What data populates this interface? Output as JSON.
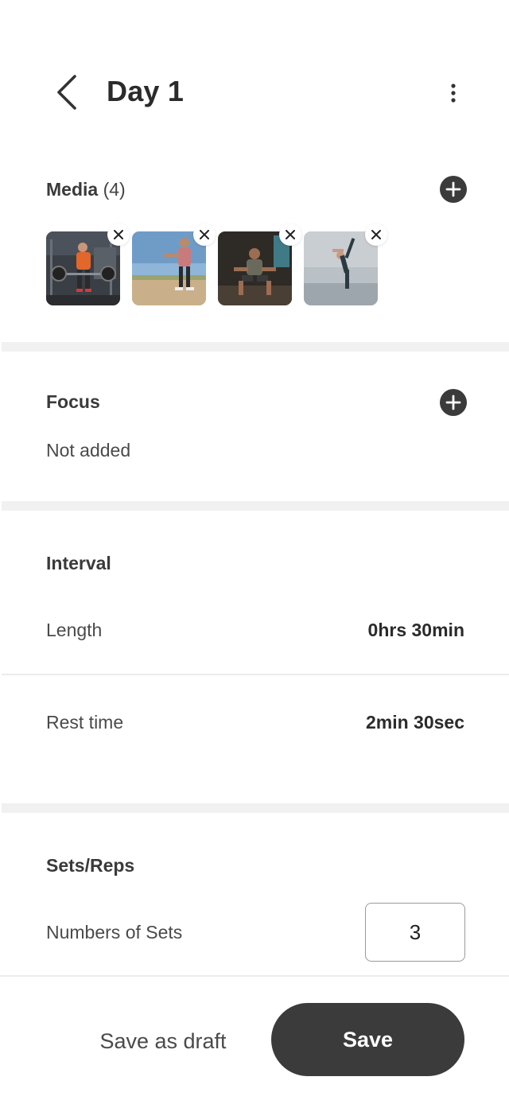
{
  "header": {
    "title": "Day 1",
    "back_icon": "chevron-left-icon",
    "more_icon": "more-vertical-icon"
  },
  "media": {
    "label": "Media",
    "count": "(4)",
    "add_icon": "plus-circle-icon",
    "items": [
      {
        "subject": "deadlift-gym",
        "remove_icon": "close-icon"
      },
      {
        "subject": "outdoor-stretch",
        "remove_icon": "close-icon"
      },
      {
        "subject": "squat-dark-room",
        "remove_icon": "close-icon"
      },
      {
        "subject": "yoga-pose",
        "remove_icon": "close-icon"
      }
    ]
  },
  "focus": {
    "label": "Focus",
    "value": "Not added",
    "add_icon": "plus-circle-icon"
  },
  "interval": {
    "label": "Interval",
    "length_label": "Length",
    "length_value": "0hrs 30min",
    "rest_label": "Rest time",
    "rest_value": "2min 30sec"
  },
  "sets_reps": {
    "label": "Sets/Reps",
    "sets_label": "Numbers of Sets",
    "sets_value": "3"
  },
  "footer": {
    "draft_label": "Save as draft",
    "save_label": "Save"
  },
  "colors": {
    "primary_dark": "#3b3b3b",
    "band": "#f1f1f1",
    "text": "#2f2f2f"
  }
}
